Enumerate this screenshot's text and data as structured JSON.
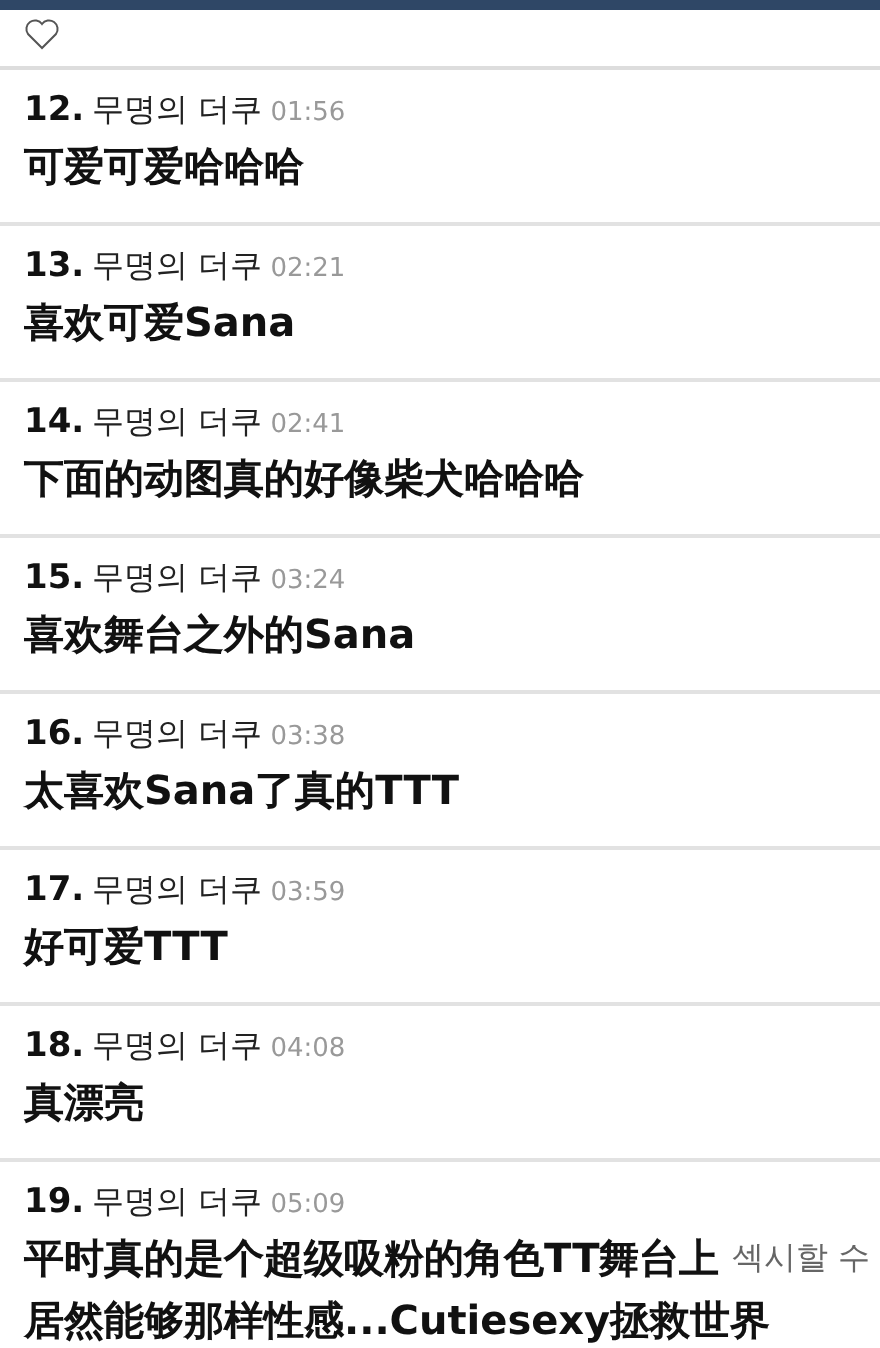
{
  "comments": [
    {
      "number": "12.",
      "author": "무명의 더쿠",
      "time": "01:56",
      "lines": [
        "可爱可爱哈哈哈"
      ]
    },
    {
      "number": "13.",
      "author": "무명의 더쿠",
      "time": "02:21",
      "lines": [
        "喜欢可爱Sana"
      ]
    },
    {
      "number": "14.",
      "author": "무명의 더쿠",
      "time": "02:41",
      "lines": [
        "下面的动图真的好像柴犬哈哈哈"
      ]
    },
    {
      "number": "15.",
      "author": "무명의 더쿠",
      "time": "03:24",
      "lines": [
        "喜欢舞台之外的Sana"
      ]
    },
    {
      "number": "16.",
      "author": "무명의 더쿠",
      "time": "03:38",
      "lines": [
        "太喜欢Sana了真的TTT"
      ]
    },
    {
      "number": "17.",
      "author": "무명의 더쿠",
      "time": "03:59",
      "lines": [
        "好可爱TTT"
      ]
    },
    {
      "number": "18.",
      "author": "무명의 더쿠",
      "time": "04:08",
      "lines": [
        "真漂亮"
      ]
    },
    {
      "number": "19.",
      "author": "무명의 더쿠",
      "time": "05:09",
      "lines": [
        "平时真的是个超级吸粉的角色TT舞台上",
        "居然能够那样性感...Cutiesexy拯救世界"
      ],
      "underlying_text": "섹시할 수"
    }
  ]
}
